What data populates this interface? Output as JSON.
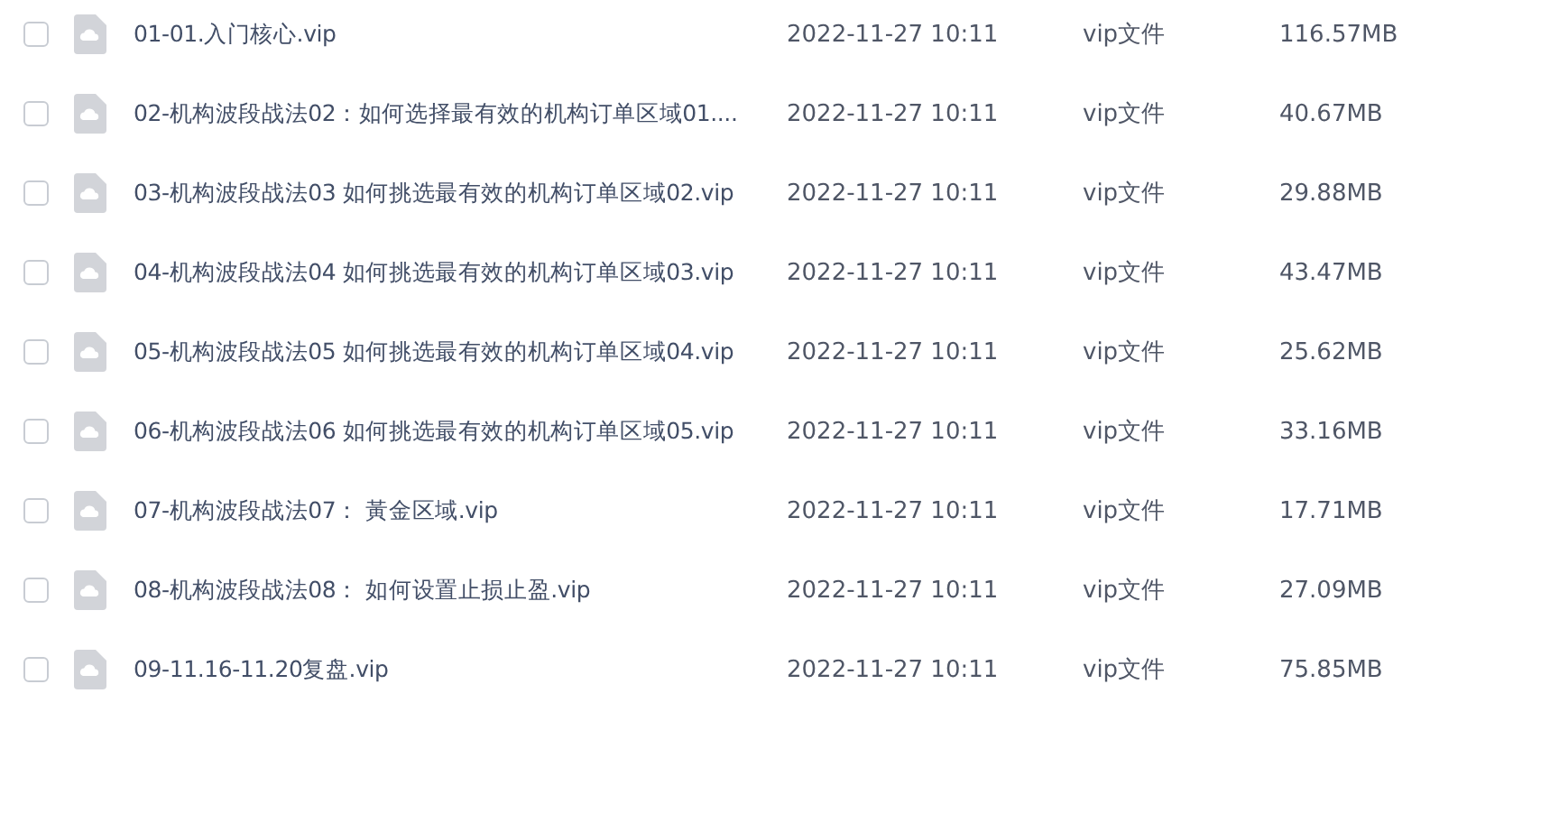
{
  "files": [
    {
      "name": "01-01.入门核心.vip",
      "modified": "2022-11-27 10:11",
      "type": "vip文件",
      "size": "116.57MB",
      "checked": false
    },
    {
      "name": "02-机构波段战法02：如何选择最有效的机构订单区域01....",
      "modified": "2022-11-27 10:11",
      "type": "vip文件",
      "size": "40.67MB",
      "checked": false
    },
    {
      "name": "03-机构波段战法03 如何挑选最有效的机构订单区域02.vip",
      "modified": "2022-11-27 10:11",
      "type": "vip文件",
      "size": "29.88MB",
      "checked": false
    },
    {
      "name": "04-机构波段战法04 如何挑选最有效的机构订单区域03.vip",
      "modified": "2022-11-27 10:11",
      "type": "vip文件",
      "size": "43.47MB",
      "checked": false
    },
    {
      "name": "05-机构波段战法05 如何挑选最有效的机构订单区域04.vip",
      "modified": "2022-11-27 10:11",
      "type": "vip文件",
      "size": "25.62MB",
      "checked": false
    },
    {
      "name": "06-机构波段战法06 如何挑选最有效的机构订单区域05.vip",
      "modified": "2022-11-27 10:11",
      "type": "vip文件",
      "size": "33.16MB",
      "checked": false
    },
    {
      "name": "07-机构波段战法07： 黃金区域.vip",
      "modified": "2022-11-27 10:11",
      "type": "vip文件",
      "size": "17.71MB",
      "checked": false
    },
    {
      "name": "08-机构波段战法08： 如何设置止损止盈.vip",
      "modified": "2022-11-27 10:11",
      "type": "vip文件",
      "size": "27.09MB",
      "checked": false
    },
    {
      "name": "09-11.16-11.20复盘.vip",
      "modified": "2022-11-27 10:11",
      "type": "vip文件",
      "size": "75.85MB",
      "checked": false
    }
  ]
}
